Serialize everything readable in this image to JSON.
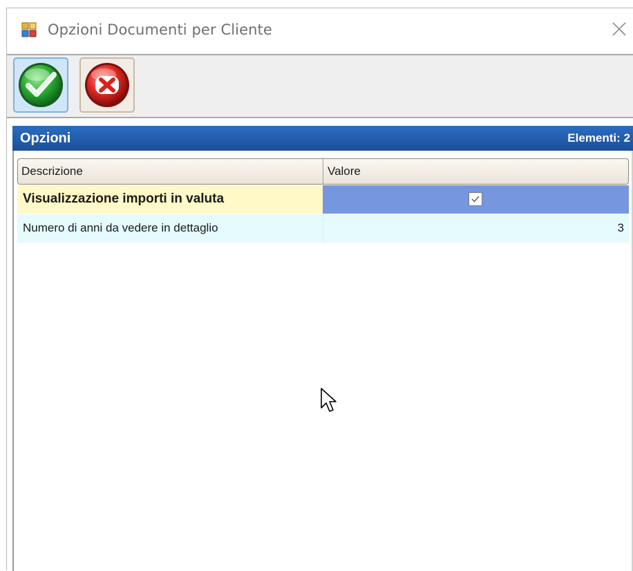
{
  "window": {
    "title": "Opzioni Documenti per Cliente",
    "close_glyph": "×"
  },
  "toolbar": {
    "buttons": [
      {
        "name": "ok",
        "icon": "green-check-icon",
        "color": "#22a83a"
      },
      {
        "name": "cancel",
        "icon": "red-x-icon",
        "color": "#d92020"
      }
    ]
  },
  "panel": {
    "title": "Opzioni",
    "count_label": "Elementi: 2",
    "header_color": "#1f5aa8"
  },
  "grid": {
    "columns": [
      "Descrizione",
      "Valore"
    ],
    "rows": [
      {
        "description": "Visualizzazione importi in valuta",
        "value_type": "checkbox",
        "checked": true,
        "selected": true
      },
      {
        "description": "Numero di anni da vedere in dettaglio",
        "value": "3"
      }
    ]
  },
  "colors": {
    "selected_value_bg": "#7696e0",
    "selected_desc_bg": "#fff8c7",
    "row_bg": "#e5fbfd"
  }
}
